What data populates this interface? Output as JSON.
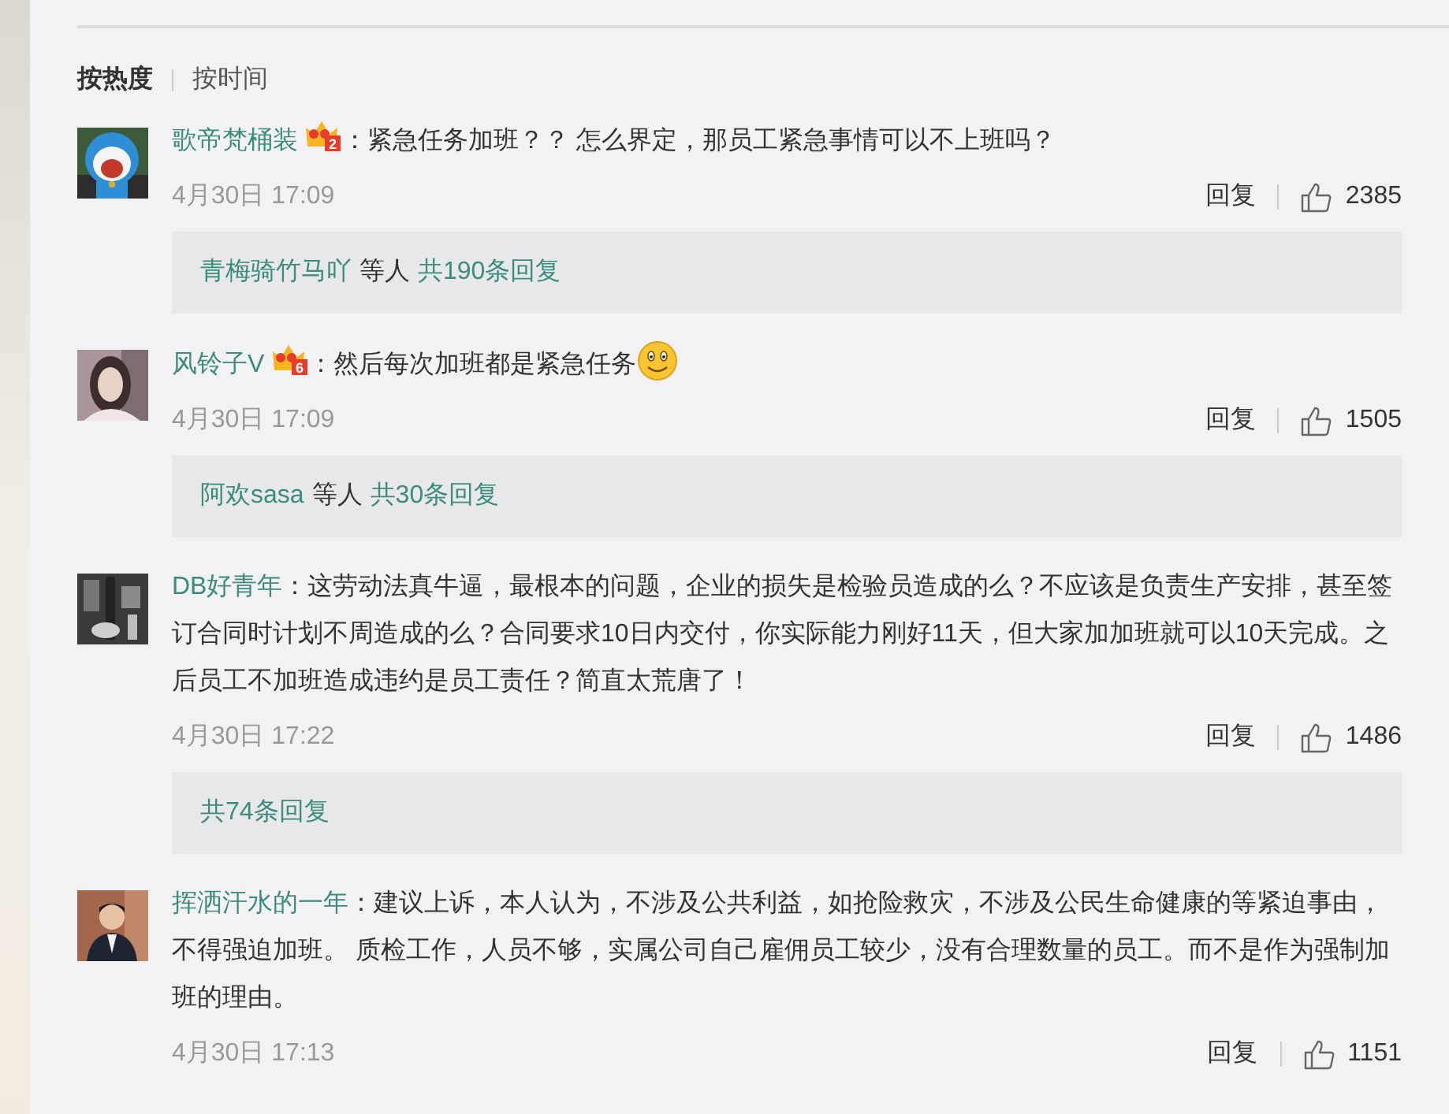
{
  "sort_tabs": [
    {
      "label": "按热度",
      "selected": true
    },
    {
      "label": "按时间",
      "selected": false
    }
  ],
  "comments": [
    {
      "user": "歌帝梵桶装",
      "badge": "2",
      "text": "：紧急任务加班？？ 怎么界定，那员工紧急事情可以不上班吗？",
      "emoji": false,
      "time": "4月30日 17:09",
      "reply_action": "回复",
      "likes": "2385",
      "replies": {
        "users": "青梅骑竹马吖",
        "suffix": "等人",
        "total": "共190条回复"
      }
    },
    {
      "user": "风铃子V",
      "badge": "6",
      "text": "：然后每次加班都是紧急任务",
      "emoji": true,
      "time": "4月30日 17:09",
      "reply_action": "回复",
      "likes": "1505",
      "replies": {
        "users": "阿欢sasa",
        "suffix": "等人",
        "total": "共30条回复"
      }
    },
    {
      "user": "DB好青年",
      "text": "：这劳动法真牛逼，最根本的问题，企业的损失是检验员造成的么？不应该是负责生产安排，甚至签订合同时计划不周造成的么？合同要求10日内交付，你实际能力刚好11天，但大家加加班就可以10天完成。之后员工不加班造成违约是员工责任？简直太荒唐了！",
      "emoji": false,
      "time": "4月30日 17:22",
      "reply_action": "回复",
      "likes": "1486",
      "replies": {
        "total": "共74条回复"
      }
    },
    {
      "user": "挥洒汗水的一年",
      "text": "：建议上诉，本人认为，不涉及公共利益，如抢险救灾，不涉及公民生命健康的等紧迫事由，不得强迫加班。 质检工作，人员不够，实属公司自己雇佣员工较少，没有合理数量的员工。而不是作为强制加班的理由。",
      "emoji": false,
      "time": "4月30日 17:13",
      "reply_action": "回复",
      "likes": "1151"
    }
  ]
}
